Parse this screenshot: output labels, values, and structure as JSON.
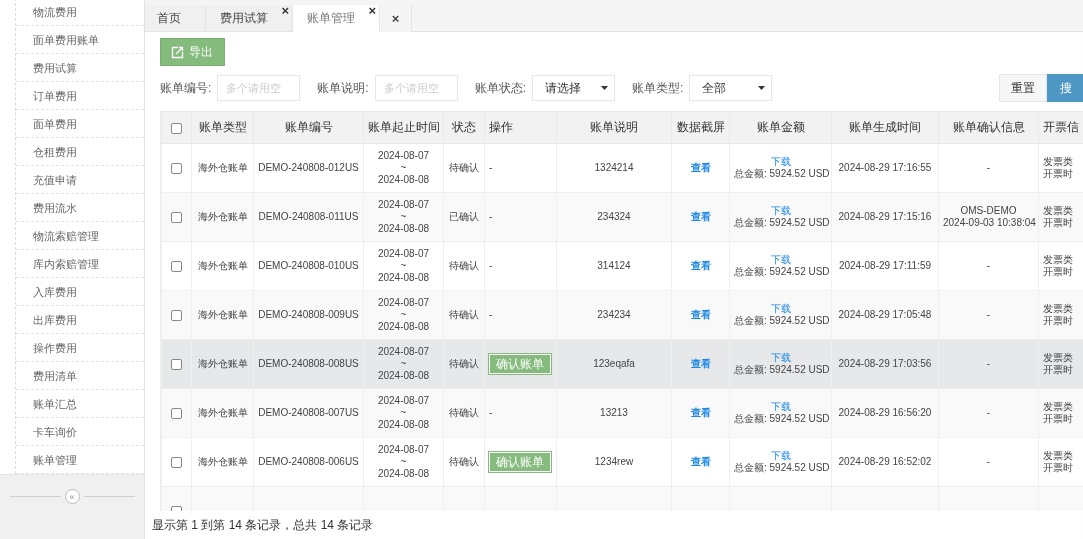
{
  "sidebar": {
    "items": [
      {
        "label": "物流费用",
        "selected": false
      },
      {
        "label": "面单费用账单",
        "selected": false
      },
      {
        "label": "费用试算",
        "selected": false
      },
      {
        "label": "订单费用",
        "selected": false
      },
      {
        "label": "面单费用",
        "selected": false
      },
      {
        "label": "仓租费用",
        "selected": false
      },
      {
        "label": "充值申请",
        "selected": false
      },
      {
        "label": "费用流水",
        "selected": false
      },
      {
        "label": "物流索赔管理",
        "selected": false
      },
      {
        "label": "库内索赔管理",
        "selected": false
      },
      {
        "label": "入库费用",
        "selected": false
      },
      {
        "label": "出库费用",
        "selected": false
      },
      {
        "label": "操作费用",
        "selected": false
      },
      {
        "label": "费用清单",
        "selected": false
      },
      {
        "label": "账单汇总",
        "selected": false
      },
      {
        "label": "卡车询价",
        "selected": false
      },
      {
        "label": "账单管理",
        "selected": false
      }
    ],
    "collapse": "«"
  },
  "tabs": [
    {
      "label": "首页",
      "selected": false
    },
    {
      "label": "费用试算",
      "close": "×",
      "selected": false
    },
    {
      "label": "账单管理",
      "close": "×",
      "selected": true
    }
  ],
  "close_all": "×",
  "toolbar": {
    "export": "导出"
  },
  "filters": [
    {
      "kind": "input",
      "label": "账单编号:",
      "placeholder": "多个请用空"
    },
    {
      "kind": "input",
      "label": "账单说明:",
      "placeholder": "多个请用空"
    },
    {
      "kind": "select",
      "label": "账单状态:",
      "value": "请选择"
    },
    {
      "kind": "select",
      "label": "账单类型:",
      "value": "全部"
    }
  ],
  "buttons": {
    "reset": "重置",
    "search": "搜"
  },
  "table": {
    "select_all_checked": false,
    "columns": [
      "账单类型",
      "账单编号",
      "账单起止时间",
      "状态",
      "操作",
      "账单说明",
      "数据截屏",
      "账单金额",
      "账单生成时间",
      "账单确认信息",
      "开票信"
    ],
    "rows": [
      {
        "checked": false,
        "selected": false,
        "type": "海外仓账单",
        "number": "DEMO-240808-012US",
        "period": [
          "2024-08-07",
          "~",
          "2024-08-08"
        ],
        "status": "待确认",
        "action": {
          "kind": "text",
          "label": "-"
        },
        "desc": "1324214",
        "screen": "查看",
        "amount": [
          "下载",
          "总金额: 5924.52 USD"
        ],
        "created": "2024-08-29 17:16:55",
        "confirm": [
          "-"
        ],
        "invoice": [
          "发票类",
          "开票时"
        ]
      },
      {
        "checked": false,
        "selected": false,
        "type": "海外仓账单",
        "number": "DEMO-240808-011US",
        "period": [
          "2024-08-07",
          "~",
          "2024-08-08"
        ],
        "status": "已确认",
        "action": {
          "kind": "text",
          "label": "-"
        },
        "desc": "234324",
        "screen": "查看",
        "amount": [
          "下载",
          "总金额: 5924.52 USD"
        ],
        "created": "2024-08-29 17:15:16",
        "confirm": [
          "OMS-DEMO",
          "2024-09-03 10:38:04"
        ],
        "invoice": [
          "发票类",
          "开票时"
        ]
      },
      {
        "checked": false,
        "selected": false,
        "type": "海外仓账单",
        "number": "DEMO-240808-010US",
        "period": [
          "2024-08-07",
          "~",
          "2024-08-08"
        ],
        "status": "待确认",
        "action": {
          "kind": "text",
          "label": "-"
        },
        "desc": "314124",
        "screen": "查看",
        "amount": [
          "下载",
          "总金额: 5924.52 USD"
        ],
        "created": "2024-08-29 17:11:59",
        "confirm": [
          "-"
        ],
        "invoice": [
          "发票类",
          "开票时"
        ]
      },
      {
        "checked": false,
        "selected": false,
        "type": "海外仓账单",
        "number": "DEMO-240808-009US",
        "period": [
          "2024-08-07",
          "~",
          "2024-08-08"
        ],
        "status": "待确认",
        "action": {
          "kind": "text",
          "label": "-"
        },
        "desc": "234234",
        "screen": "查看",
        "amount": [
          "下载",
          "总金额: 5924.52 USD"
        ],
        "created": "2024-08-29 17:05:48",
        "confirm": [
          "-"
        ],
        "invoice": [
          "发票类",
          "开票时"
        ]
      },
      {
        "checked": false,
        "selected": true,
        "type": "海外仓账单",
        "number": "DEMO-240808-008US",
        "period": [
          "2024-08-07",
          "~",
          "2024-08-08"
        ],
        "status": "待确认",
        "action": {
          "kind": "button",
          "label": "确认账单"
        },
        "desc": "123eqafa",
        "screen": "查看",
        "amount": [
          "下载",
          "总金额: 5924.52 USD"
        ],
        "created": "2024-08-29 17:03:56",
        "confirm": [
          "-"
        ],
        "invoice": [
          "发票类",
          "开票时"
        ]
      },
      {
        "checked": false,
        "selected": false,
        "type": "海外仓账单",
        "number": "DEMO-240808-007US",
        "period": [
          "2024-08-07",
          "~",
          "2024-08-08"
        ],
        "status": "待确认",
        "action": {
          "kind": "text",
          "label": "-"
        },
        "desc": "13213",
        "screen": "查看",
        "amount": [
          "下载",
          "总金额: 5924.52 USD"
        ],
        "created": "2024-08-29 16:56:20",
        "confirm": [
          "-"
        ],
        "invoice": [
          "发票类",
          "开票时"
        ]
      },
      {
        "checked": false,
        "selected": false,
        "type": "海外仓账单",
        "number": "DEMO-240808-006US",
        "period": [
          "2024-08-07",
          "~",
          "2024-08-08"
        ],
        "status": "待确认",
        "action": {
          "kind": "button",
          "label": "确认账单"
        },
        "desc": "1234rew",
        "screen": "查看",
        "amount": [
          "下载",
          "总金额: 5924.52 USD"
        ],
        "created": "2024-08-29 16:52:02",
        "confirm": [
          "-"
        ],
        "invoice": [
          "发票类",
          "开票时"
        ]
      },
      {
        "checked": false,
        "selected": false
      }
    ]
  },
  "footer": "显示第 1 到第 14 条记录，总共 14 条记录"
}
